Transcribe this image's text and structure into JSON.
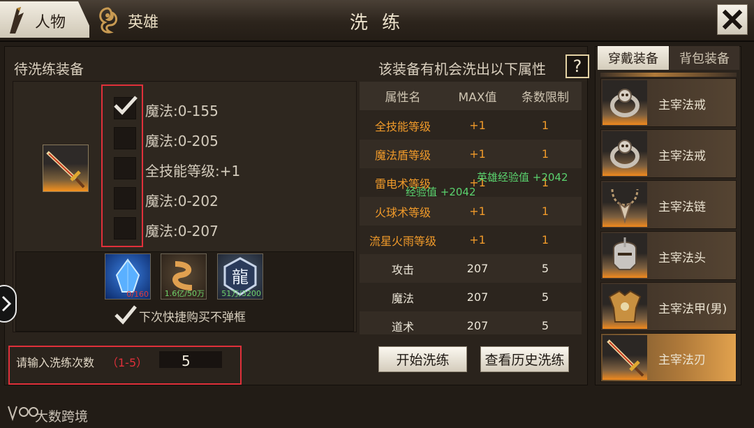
{
  "header": {
    "tab_character": "人物",
    "tab_hero": "英雄",
    "title": "洗 练",
    "close_icon": "close-icon"
  },
  "left_panel": {
    "title": "待洗练装备",
    "equipped_item_icon": "sword-icon",
    "attributes": [
      {
        "label": "魔法:0-155",
        "checked": true
      },
      {
        "label": "魔法:0-205",
        "checked": false
      },
      {
        "label": "全技能等级:+1",
        "checked": false
      },
      {
        "label": "魔法:0-202",
        "checked": false
      },
      {
        "label": "魔法:0-207",
        "checked": false
      }
    ],
    "materials": [
      {
        "icon": "blue-crystal-icon",
        "qty": "0/160",
        "qty_color": "#e03a3a"
      },
      {
        "icon": "gold-ribbon-icon",
        "qty": "1.6亿/50万",
        "qty_color": "#6ed26a"
      },
      {
        "icon": "dragon-seal-icon",
        "qty": "51万/3200",
        "qty_color": "#6ed26a"
      }
    ],
    "quick_buy_checked": true,
    "quick_buy_label": "下次快捷购买不弹框",
    "count_label": "请输入洗练次数",
    "count_range": "（1-5）",
    "count_value": "5"
  },
  "table_panel": {
    "title": "该装备有机会洗出以下属性",
    "help_label": "?",
    "headers": [
      "属性名",
      "MAX值",
      "条数限制"
    ],
    "rows": [
      {
        "name": "全技能等级",
        "max": "+1",
        "limit": "1",
        "accent": true
      },
      {
        "name": "魔法盾等级",
        "max": "+1",
        "limit": "1",
        "accent": true
      },
      {
        "name": "雷电术等级",
        "max": "+1",
        "limit": "1",
        "accent": true
      },
      {
        "name": "火球术等级",
        "max": "+1",
        "limit": "1",
        "accent": true
      },
      {
        "name": "流星火雨等级",
        "max": "+1",
        "limit": "1",
        "accent": true
      },
      {
        "name": "攻击",
        "max": "207",
        "limit": "5",
        "accent": false
      },
      {
        "name": "魔法",
        "max": "207",
        "limit": "5",
        "accent": false
      },
      {
        "name": "道术",
        "max": "207",
        "limit": "5",
        "accent": false
      }
    ],
    "float_texts": [
      "英雄经验值 +2042",
      "经验值 +2042"
    ],
    "start_button": "开始洗练",
    "history_button": "查看历史洗练"
  },
  "right_panel": {
    "tab_equipped": "穿戴装备",
    "tab_bag": "背包装备",
    "items": [
      {
        "name": "主宰法戒",
        "icon": "ring-icon",
        "selected": false
      },
      {
        "name": "主宰法戒",
        "icon": "ring-icon",
        "selected": false
      },
      {
        "name": "主宰法链",
        "icon": "necklace-icon",
        "selected": false
      },
      {
        "name": "主宰法头",
        "icon": "helmet-icon",
        "selected": false
      },
      {
        "name": "主宰法甲(男)",
        "icon": "armor-icon",
        "selected": false
      },
      {
        "name": "主宰法刃",
        "icon": "sword-icon",
        "selected": true
      }
    ]
  },
  "watermark": "大数跨境",
  "colors": {
    "accent_orange": "#f09a2a",
    "highlight_red": "#e0303a",
    "float_green": "#5ad26e"
  }
}
